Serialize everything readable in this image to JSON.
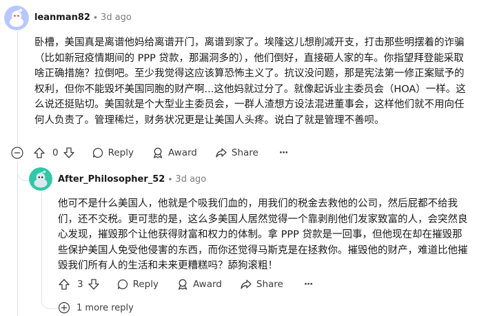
{
  "colors": {
    "meta": "#7c7c7c",
    "text": "#1a1a1b",
    "thread_line": "#dfe3e6",
    "avatar1": "#b8c7ff",
    "avatar2": "#2ec9a6"
  },
  "comment1": {
    "username": "leanman82",
    "separator": "•",
    "time": "3d ago",
    "body": "卧槽，美国真是离谱他妈给离谱开门，离谱到家了。埃隆这儿想削减开支，打击那些明摆着的诈骗（比如新冠疫情期间的 PPP 贷款，那漏洞多的），他们倒好，直接砸人家的车。你指望拜登能采取啥正确措施？拉倒吧。至少我觉得这应该算恐怖主义了。抗议没问题，那是宪法第一修正案赋予的权利，但你不能毁坏美国同胞的财产啊...这他妈就过分了。就像起诉业主委员会（HOA）一样。这么说还挺贴切。美国就是个大型业主委员会，一群人渣想方设法混进董事会，这样他们就不用向任何人负责了。管理稀烂，财务状况更是让美国人头疼。说白了就是管理不善呗。",
    "score": "0",
    "reply_label": "Reply",
    "award_label": "Award",
    "share_label": "Share",
    "more_label": "···"
  },
  "comment2": {
    "username": "After_Philosopher_52",
    "separator": "•",
    "time": "3d ago",
    "body": "他可不是什么美国人，他就是个吸我们血的，用我们的税金去救他的公司，然后屁都不给我们，还不交税。更可悲的是，这么多美国人居然觉得一个靠剥削他们发家致富的人，会突然良心发现，摧毁那个让他获得财富和权力的体制。拿 PPP 贷款是一回事，但他现在却在摧毁那些保护美国人免受他侵害的东西，而你还觉得马斯克是在拯救你。摧毁他的财产，难道比他摧毁我们所有人的生活和未来更糟糕吗？舔狗滚粗！",
    "score": "3",
    "reply_label": "Reply",
    "award_label": "Award",
    "share_label": "Share",
    "more_label": "···"
  },
  "more_replies": {
    "label": "1 more reply"
  },
  "icons": {
    "collapse": "collapse-minus-icon",
    "upvote": "upvote-arrow-icon",
    "downvote": "downvote-arrow-icon",
    "reply": "speech-bubble-icon",
    "award": "award-ribbon-icon",
    "share": "share-arrow-icon",
    "expand": "expand-plus-icon"
  }
}
